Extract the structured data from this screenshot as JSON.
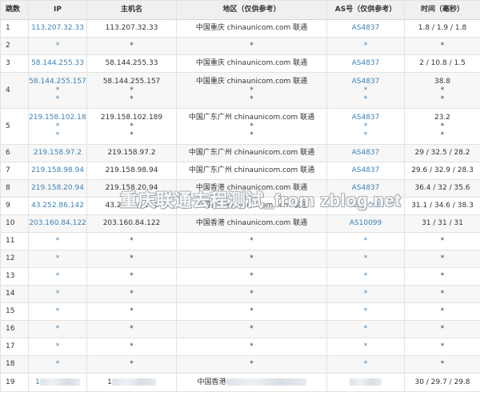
{
  "headers": {
    "hop": "跳数",
    "ip": "IP",
    "host": "主机名",
    "region": "地区（仅供参考）",
    "as": "AS号（仅供参考）",
    "time": "时间（毫秒）"
  },
  "rows": [
    {
      "hop": "1",
      "ip": [
        "113.207.32.33"
      ],
      "host": [
        "113.207.32.33"
      ],
      "region": [
        "中国重庆 chinaunicom.com 联通"
      ],
      "as": [
        "AS4837"
      ],
      "time": [
        "1.8 / 1.9 / 1.8"
      ]
    },
    {
      "hop": "2",
      "ip": [
        "*"
      ],
      "host": [
        "*"
      ],
      "region": [
        "*"
      ],
      "as": [
        "*"
      ],
      "time": [
        "*"
      ]
    },
    {
      "hop": "3",
      "ip": [
        "58.144.255.33"
      ],
      "host": [
        "58.144.255.33"
      ],
      "region": [
        "中国重庆 chinaunicom.com 联通"
      ],
      "as": [
        "AS4837"
      ],
      "time": [
        "2 / 10.8 / 1.5"
      ]
    },
    {
      "hop": "4",
      "ip": [
        "58.144.255.157",
        "*",
        "*"
      ],
      "host": [
        "58.144.255.157",
        "*",
        "*"
      ],
      "region": [
        "中国重庆 chinaunicom.com 联通",
        "*",
        "*"
      ],
      "as": [
        "AS4837",
        "*",
        "*"
      ],
      "time": [
        "38.8",
        "*",
        "*"
      ]
    },
    {
      "hop": "5",
      "ip": [
        "219.158.102.189",
        "*",
        "*"
      ],
      "host": [
        "219.158.102.189",
        "*",
        "*"
      ],
      "region": [
        "中国广东广州 chinaunicom.com 联通",
        "*",
        "*"
      ],
      "as": [
        "AS4837",
        "*",
        "*"
      ],
      "time": [
        "23.2",
        "*",
        "*"
      ]
    },
    {
      "hop": "6",
      "ip": [
        "219.158.97.2"
      ],
      "host": [
        "219.158.97.2"
      ],
      "region": [
        "中国广东广州 chinaunicom.com 联通"
      ],
      "as": [
        "AS4837"
      ],
      "time": [
        "29 / 32.5 / 28.2"
      ]
    },
    {
      "hop": "7",
      "ip": [
        "219.158.98.94"
      ],
      "host": [
        "219.158.98.94"
      ],
      "region": [
        "中国广东广州 chinaunicom.com 联通"
      ],
      "as": [
        "AS4837"
      ],
      "time": [
        "29.6 / 32.9 / 28.3"
      ]
    },
    {
      "hop": "8",
      "ip": [
        "219.158.20.94"
      ],
      "host": [
        "219.158.20.94"
      ],
      "region": [
        "中国香港 chinaunicom.com 联通"
      ],
      "as": [
        "AS4837"
      ],
      "time": [
        "36.4 / 32 / 35.6"
      ]
    },
    {
      "hop": "9",
      "ip": [
        "43.252.86.142"
      ],
      "host": [
        "43.252.86.142"
      ],
      "region": [
        "中国香港 chinaunicom.com 联通"
      ],
      "as": [
        "AS10099"
      ],
      "time": [
        "31.1 / 34.6 / 38.3"
      ]
    },
    {
      "hop": "10",
      "ip": [
        "203.160.84.122"
      ],
      "host": [
        "203.160.84.122"
      ],
      "region": [
        "中国香港 chinaunicom.com 联通"
      ],
      "as": [
        "AS10099"
      ],
      "time": [
        "31 / 31 / 31"
      ]
    },
    {
      "hop": "11",
      "ip": [
        "*"
      ],
      "host": [
        "*"
      ],
      "region": [
        "*"
      ],
      "as": [
        "*"
      ],
      "time": [
        "*"
      ]
    },
    {
      "hop": "12",
      "ip": [
        "*"
      ],
      "host": [
        "*"
      ],
      "region": [
        "*"
      ],
      "as": [
        "*"
      ],
      "time": [
        "*"
      ]
    },
    {
      "hop": "13",
      "ip": [
        "*"
      ],
      "host": [
        "*"
      ],
      "region": [
        "*"
      ],
      "as": [
        "*"
      ],
      "time": [
        "*"
      ]
    },
    {
      "hop": "14",
      "ip": [
        "*"
      ],
      "host": [
        "*"
      ],
      "region": [
        "*"
      ],
      "as": [
        "*"
      ],
      "time": [
        "*"
      ]
    },
    {
      "hop": "15",
      "ip": [
        "*"
      ],
      "host": [
        "*"
      ],
      "region": [
        "*"
      ],
      "as": [
        "*"
      ],
      "time": [
        "*"
      ]
    },
    {
      "hop": "16",
      "ip": [
        "*"
      ],
      "host": [
        "*"
      ],
      "region": [
        "*"
      ],
      "as": [
        "*"
      ],
      "time": [
        "*"
      ]
    },
    {
      "hop": "17",
      "ip": [
        "*"
      ],
      "host": [
        "*"
      ],
      "region": [
        "*"
      ],
      "as": [
        "*"
      ],
      "time": [
        "*"
      ]
    },
    {
      "hop": "18",
      "ip": [
        "*"
      ],
      "host": [
        "*"
      ],
      "region": [
        "*"
      ],
      "as": [
        "*"
      ],
      "time": [
        "*"
      ]
    },
    {
      "hop": "19",
      "ip": [
        "1"
      ],
      "host": [
        "1"
      ],
      "region": [
        "中国香港"
      ],
      "as": [
        ""
      ],
      "time": [
        "30 / 29.7 / 29.8"
      ],
      "redacted": true
    }
  ],
  "watermark": "重庆联通去程测试_from zblog.net",
  "colors": {
    "link": "#3b82b8",
    "header_bg": "#f0f0f0",
    "stripe": "#f7f7f7",
    "border": "#e2e2e2"
  }
}
